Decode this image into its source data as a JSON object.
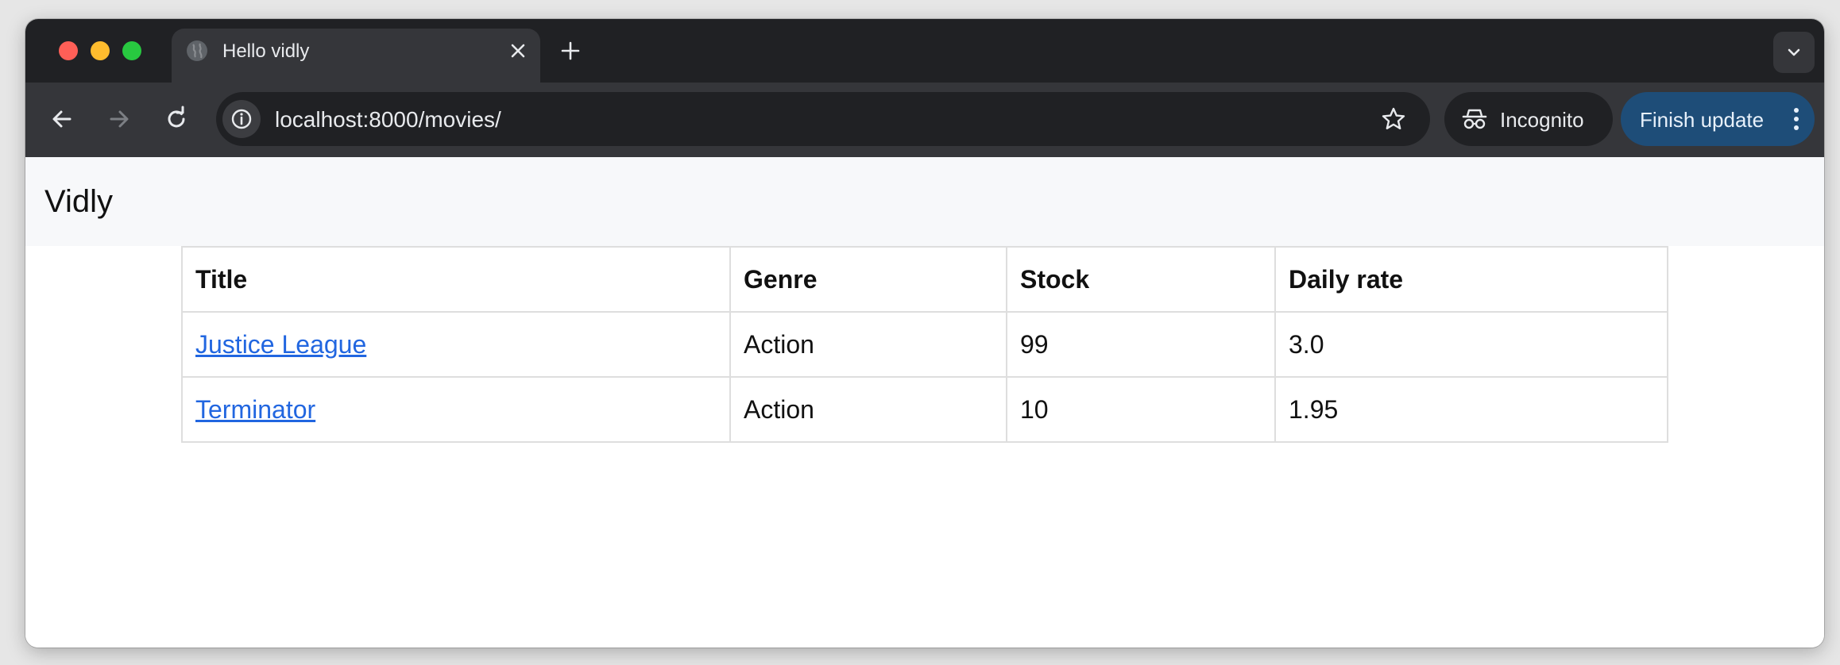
{
  "browser": {
    "tab_title": "Hello vidly",
    "url": "localhost:8000/movies/",
    "incognito_label": "Incognito",
    "update_label": "Finish update"
  },
  "app": {
    "brand": "Vidly"
  },
  "table": {
    "headers": [
      "Title",
      "Genre",
      "Stock",
      "Daily rate"
    ],
    "rows": [
      [
        "Justice League",
        "Action",
        "99",
        "3.0"
      ],
      [
        "Terminator",
        "Action",
        "10",
        "1.95"
      ]
    ]
  },
  "colors": {
    "tab_strip": "#202124",
    "toolbar": "#35363a",
    "update_button": "#1e4d78",
    "link": "#2166e0",
    "navbar": "#f7f8fa"
  },
  "icons": [
    "globe-icon",
    "close-icon",
    "plus-icon",
    "chevron-down-icon",
    "back-arrow-icon",
    "forward-arrow-icon",
    "reload-icon",
    "info-icon",
    "star-icon",
    "incognito-icon",
    "kebab-menu-icon"
  ]
}
